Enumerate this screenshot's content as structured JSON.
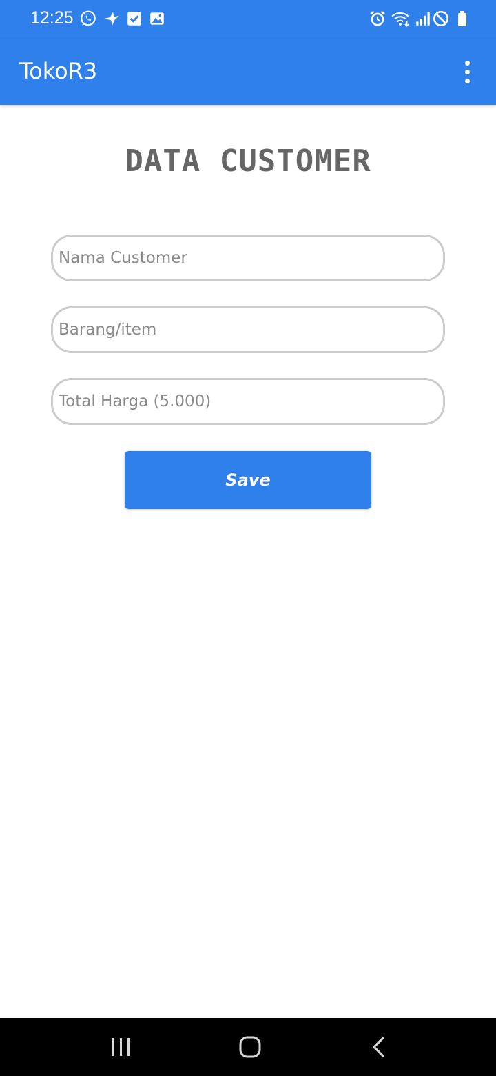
{
  "status_bar": {
    "time": "12:25",
    "icons": [
      "whatsapp-icon",
      "bird-icon",
      "check-box-icon",
      "image-icon",
      "alarm-icon",
      "wifi-icon",
      "signal-icon",
      "do-not-disturb-icon",
      "battery-icon"
    ]
  },
  "app_bar": {
    "title": "TokoR3",
    "menu_icon": "more-vertical-icon"
  },
  "main": {
    "title": "DATA CUSTOMER",
    "fields": [
      {
        "placeholder": "Nama Customer",
        "value": ""
      },
      {
        "placeholder": "Barang/item",
        "value": ""
      },
      {
        "placeholder": "Total Harga (5.000)",
        "value": ""
      }
    ],
    "save_label": "Save"
  },
  "nav_bar": {
    "icons": [
      "recent-apps-icon",
      "home-icon",
      "back-icon"
    ]
  },
  "colors": {
    "primary": "#2f80ea",
    "title_text": "#666666",
    "field_border": "#cccccc",
    "nav_bar": "#000000"
  }
}
